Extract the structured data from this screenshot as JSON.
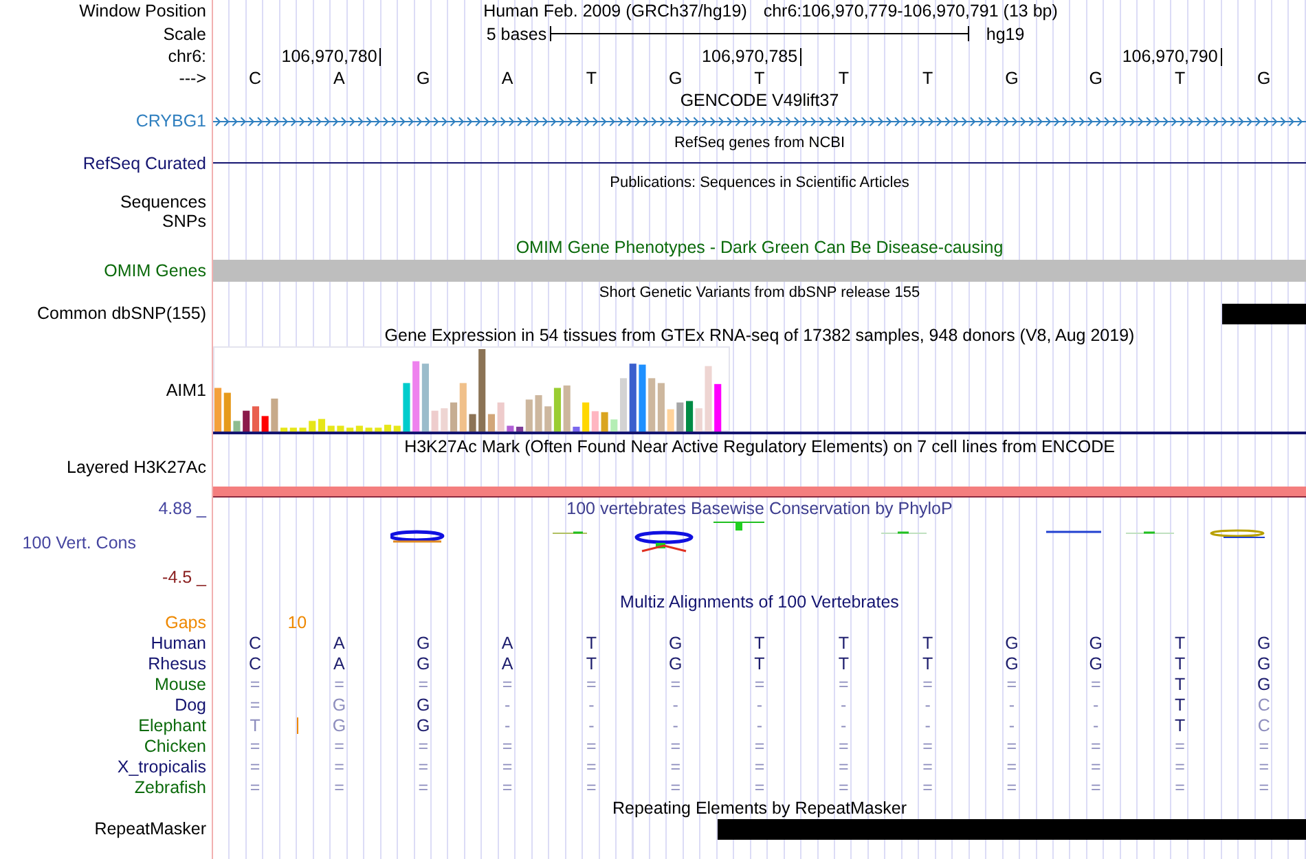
{
  "header": {
    "position_label": "Window Position",
    "assembly_text": "Human Feb. 2009 (GRCh37/hg19)",
    "position_text": "chr6:106,970,779-106,970,791 (13 bp)",
    "scale_label": "Scale",
    "scale_text": "5 bases",
    "scale_assembly": "hg19"
  },
  "ruler": {
    "label": "chr6:",
    "ticks": [
      "106,970,780",
      "106,970,785",
      "106,970,790"
    ]
  },
  "strand": {
    "label": "--->",
    "bases": [
      "C",
      "A",
      "G",
      "A",
      "T",
      "G",
      "T",
      "T",
      "T",
      "G",
      "G",
      "T",
      "G"
    ]
  },
  "tracks": [
    {
      "kind": "gene",
      "title": "GENCODE V49lift37",
      "labels": [
        "CRYBG1"
      ]
    },
    {
      "kind": "line",
      "title": "RefSeq genes from NCBI",
      "labels": [
        "RefSeq Curated"
      ]
    },
    {
      "kind": "empty",
      "title": "Publications: Sequences in Scientific Articles",
      "labels": [
        "Sequences",
        "SNPs"
      ]
    },
    {
      "kind": "omim",
      "title": "OMIM Gene Phenotypes - Dark Green Can Be Disease-causing",
      "labels": [
        "OMIM Genes"
      ]
    },
    {
      "kind": "snp",
      "title": "Short Genetic Variants from dbSNP release 155",
      "labels": [
        "Common dbSNP(155)"
      ]
    },
    {
      "kind": "expression",
      "title": "Gene Expression in 54 tissues from GTEx RNA-seq of 17382 samples, 948 donors (V8, Aug 2019)",
      "labels": [
        "AIM1"
      ]
    },
    {
      "kind": "h3k27ac",
      "title": "H3K27Ac Mark (Often Found Near Active Regulatory Elements) on 7 cell lines from ENCODE",
      "labels": [
        "Layered H3K27Ac"
      ]
    },
    {
      "kind": "phylop",
      "title": "100 vertebrates Basewise Conservation by PhyloP",
      "labels": [
        "100 Vert. Cons"
      ],
      "y_max": "4.88 _",
      "y_min": "-4.5 _"
    },
    {
      "kind": "multiz",
      "title": "Multiz Alignments of 100 Vertebrates",
      "gaps": {
        "label": "Gaps",
        "text": "10"
      },
      "species": [
        {
          "name": "Human",
          "color": "#141470",
          "insertion": false,
          "bases": [
            "C",
            "A",
            "G",
            "A",
            "T",
            "G",
            "T",
            "T",
            "T",
            "G",
            "G",
            "T",
            "G"
          ]
        },
        {
          "name": "Rhesus",
          "color": "#141470",
          "insertion": false,
          "bases": [
            "C",
            "A",
            "G",
            "A",
            "T",
            "G",
            "T",
            "T",
            "T",
            "G",
            "G",
            "T",
            "G"
          ]
        },
        {
          "name": "Mouse",
          "color": "#0b6a0b",
          "insertion": false,
          "bases": [
            "=",
            "=",
            "=",
            "=",
            "=",
            "=",
            "=",
            "=",
            "=",
            "=",
            "=",
            "T",
            "G"
          ]
        },
        {
          "name": "Dog",
          "color": "#141470",
          "insertion": false,
          "bases": [
            "=",
            "G",
            "G",
            "-",
            "-",
            "-",
            "-",
            "-",
            "-",
            "-",
            "-",
            "T",
            "C"
          ]
        },
        {
          "name": "Elephant",
          "color": "#0b6a0b",
          "insertion": true,
          "bases": [
            "T",
            "G",
            "G",
            "-",
            "-",
            "-",
            "-",
            "-",
            "-",
            "-",
            "-",
            "T",
            "C"
          ]
        },
        {
          "name": "Chicken",
          "color": "#0b6a0b",
          "insertion": false,
          "bases": [
            "=",
            "=",
            "=",
            "=",
            "=",
            "=",
            "=",
            "=",
            "=",
            "=",
            "=",
            "=",
            "="
          ]
        },
        {
          "name": "X_tropicalis",
          "color": "#141470",
          "insertion": false,
          "bases": [
            "=",
            "=",
            "=",
            "=",
            "=",
            "=",
            "=",
            "=",
            "=",
            "=",
            "=",
            "=",
            "="
          ]
        },
        {
          "name": "Zebrafish",
          "color": "#0b6a0b",
          "insertion": false,
          "bases": [
            "=",
            "=",
            "=",
            "=",
            "=",
            "=",
            "=",
            "=",
            "=",
            "=",
            "=",
            "=",
            "="
          ]
        }
      ]
    },
    {
      "kind": "repeat",
      "title": "Repeating Elements by RepeatMasker",
      "labels": [
        "RepeatMasker"
      ]
    }
  ]
}
